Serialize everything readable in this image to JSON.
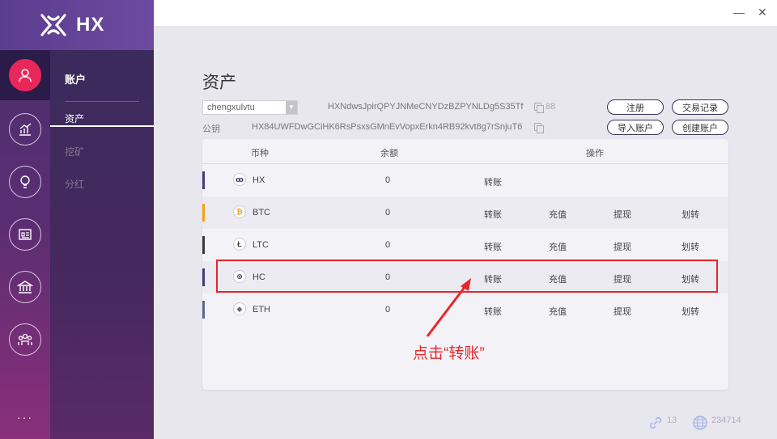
{
  "app": {
    "logo": "HX"
  },
  "rail": {
    "icons": [
      "account-icon",
      "chart-icon",
      "bulb-icon",
      "news-icon",
      "bank-icon",
      "community-icon"
    ],
    "more": "···"
  },
  "subnav": {
    "title": "账户",
    "items": [
      {
        "label": "资产",
        "active": true
      },
      {
        "label": "挖矿",
        "active": false
      },
      {
        "label": "分红",
        "active": false
      }
    ]
  },
  "window": {
    "minimize": "—",
    "close": "✕"
  },
  "main": {
    "title": "资产",
    "account_select": "chengxulvtu",
    "address": "HXNdwsJpirQPYJNMeCNYDzBZPYNLDg5S35Tf",
    "qr_label": "88",
    "pubkey_label": "公钥",
    "pubkey": "HX84UWFDwGCiHK6RsPsxsGMnEvVopxErkn4RB92kvt8g7rSnjuT6",
    "buttons": {
      "register": "注册",
      "history": "交易记录",
      "import": "导入账户",
      "create": "创建账户"
    }
  },
  "table": {
    "headers": {
      "coin": "币种",
      "balance": "余额",
      "actions": "操作"
    },
    "rows": [
      {
        "coin": "HX",
        "icon": "hx-icon",
        "glyph": "ꝏ",
        "color": "#4a3a7a",
        "balance": "0",
        "actions": [
          "转账"
        ]
      },
      {
        "coin": "BTC",
        "icon": "btc-icon",
        "glyph": "₿",
        "color": "#f2a21c",
        "balance": "0",
        "actions": [
          "转账",
          "充值",
          "提现",
          "划转"
        ]
      },
      {
        "coin": "LTC",
        "icon": "ltc-icon",
        "glyph": "Ł",
        "color": "#3a3a3a",
        "balance": "0",
        "actions": [
          "转账",
          "充值",
          "提现",
          "划转"
        ]
      },
      {
        "coin": "HC",
        "icon": "hc-icon",
        "glyph": "⊕",
        "color": "#4a3a7a",
        "balance": "0",
        "actions": [
          "转账",
          "充值",
          "提现",
          "划转"
        ]
      },
      {
        "coin": "ETH",
        "icon": "eth-icon",
        "glyph": "◆",
        "color": "#5a6a8a",
        "balance": "0",
        "actions": [
          "转账",
          "充值",
          "提现",
          "划转"
        ]
      }
    ]
  },
  "annotation": {
    "text": "点击“转账”",
    "color": "#e8262a"
  },
  "footer": {
    "links": "13",
    "block_height": "234714"
  }
}
